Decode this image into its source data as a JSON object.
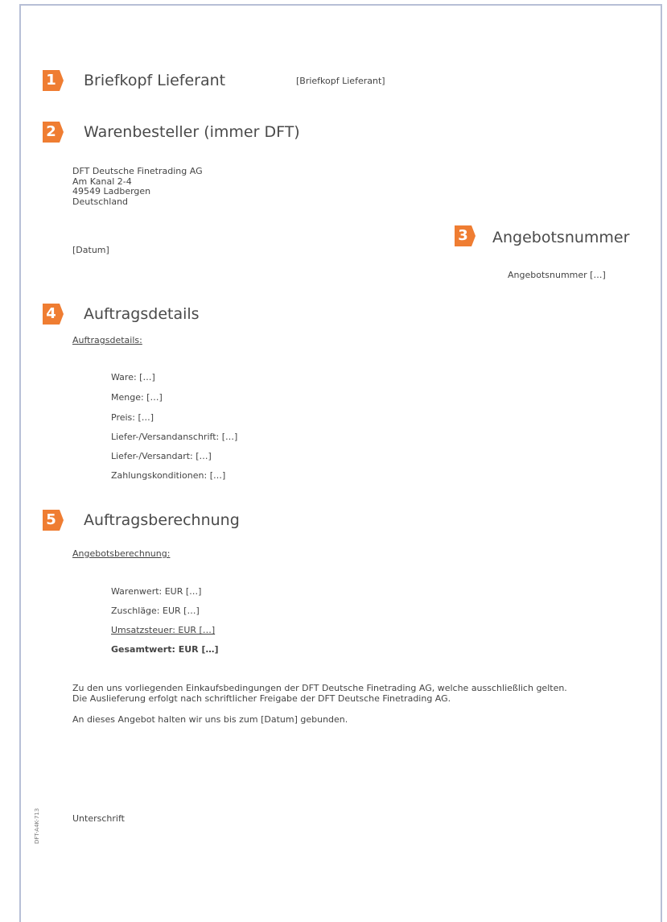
{
  "colors": {
    "accent": "#ef7d32",
    "border": "#b7bfd6"
  },
  "sections": [
    {
      "number": "1",
      "title": "Briefkopf Lieferant",
      "value": "[Briefkopf Lieferant]"
    },
    {
      "number": "2",
      "title": "Warenbesteller (immer DFT)"
    },
    {
      "number": "3",
      "title": "Angebotsnummer",
      "value": "Angebotsnummer […]"
    },
    {
      "number": "4",
      "title": "Auftragsdetails"
    },
    {
      "number": "5",
      "title": "Auftragsberechnung"
    }
  ],
  "address": [
    "DFT Deutsche Finetrading AG",
    "Am Kanal 2-4",
    "49549 Ladbergen",
    "Deutschland"
  ],
  "date_placeholder": "[Datum]",
  "details": {
    "label": "Auftragsdetails:",
    "items": [
      "Ware: […]",
      "Menge: […]",
      "Preis: […]",
      "Liefer-/Versandanschrift: […]",
      "Liefer-/Versandart: […]",
      "Zahlungskonditionen: […]"
    ]
  },
  "calculation": {
    "label": "Angebotsberechnung:",
    "items": [
      "Warenwert: EUR […]",
      "Zuschläge: EUR […]",
      "Umsatzsteuer: EUR […]"
    ],
    "total": "Gesamtwert: EUR […]"
  },
  "terms": [
    "Zu den uns vorliegenden Einkaufsbedingungen der DFT Deutsche Finetrading AG, welche ausschließlich gelten.",
    "Die Auslieferung erfolgt nach schriftlicher Freigabe der DFT Deutsche Finetrading AG."
  ],
  "binding_note": "An dieses Angebot halten wir uns bis zum [Datum] gebunden.",
  "signature_label": "Unterschrift",
  "form_code": "DFT-A4K-713"
}
